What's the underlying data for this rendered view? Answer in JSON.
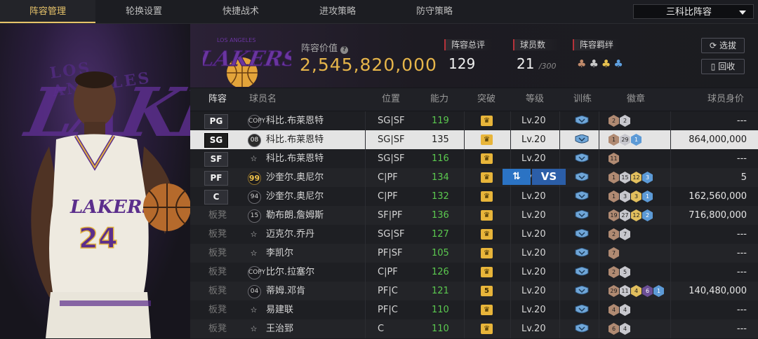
{
  "tabs": [
    "阵容管理",
    "轮换设置",
    "快捷战术",
    "进攻策略",
    "防守策略"
  ],
  "active_tab": 0,
  "team_select": {
    "value": "三科比阵容"
  },
  "logo_text": "LAKERS",
  "logo_arc": "LOS ANGELES",
  "lineup_value": {
    "label": "阵容价值",
    "value": "2,545,820,000"
  },
  "stats": {
    "rating": {
      "label": "阵容总评",
      "value": "129"
    },
    "players": {
      "label": "球员数",
      "value": "21",
      "max": "/300"
    },
    "bond": {
      "label": "阵容羁绊"
    }
  },
  "buttons": {
    "select": "选拔",
    "recycle": "回收",
    "swap_icon": "⇅",
    "vs": "VS"
  },
  "headers": {
    "lineup": "阵容",
    "name": "球员名",
    "position": "位置",
    "ability": "能力",
    "breakthrough": "突破",
    "level": "等级",
    "training": "训练",
    "badges": "徽章",
    "price": "球员身价"
  },
  "rows": [
    {
      "slot": "PG",
      "bench": false,
      "num": "COPY",
      "name": "科比.布莱恩特",
      "position": "SG|SF",
      "ability": "119",
      "ability_green": true,
      "break": "♛",
      "level": "Lv.20",
      "badges": [
        [
          "bronze",
          "2"
        ],
        [
          "silver",
          "2"
        ]
      ],
      "price": "---"
    },
    {
      "slot": "SG",
      "bench": false,
      "num": "08",
      "name": "科比.布莱恩特",
      "position": "SG|SF",
      "ability": "135",
      "ability_green": false,
      "break": "♛",
      "level": "Lv.20",
      "badges": [
        [
          "bronze",
          "1"
        ],
        [
          "silver",
          "29"
        ],
        [
          "blue",
          "1"
        ]
      ],
      "price": "864,000,000",
      "selected": true
    },
    {
      "slot": "SF",
      "bench": false,
      "num": "☆",
      "name": "科比.布莱恩特",
      "position": "SG|SF",
      "ability": "116",
      "ability_green": true,
      "break": "♛",
      "level": "Lv.20",
      "badges": [
        [
          "bronze",
          "11"
        ]
      ],
      "price": "---"
    },
    {
      "slot": "PF",
      "bench": false,
      "num": "99",
      "name": "沙奎尔.奥尼尔",
      "position": "C|PF",
      "ability": "134",
      "ability_green": true,
      "break": "♛",
      "level": "Lv.20",
      "badges": [
        [
          "bronze",
          "1"
        ],
        [
          "silver",
          "15"
        ],
        [
          "gold",
          "12"
        ],
        [
          "blue",
          "3"
        ]
      ],
      "price": "5"
    },
    {
      "slot": "C",
      "bench": false,
      "num": "94",
      "name": "沙奎尔.奥尼尔",
      "position": "C|PF",
      "ability": "132",
      "ability_green": true,
      "break": "♛",
      "level": "Lv.20",
      "badges": [
        [
          "bronze",
          "1"
        ],
        [
          "silver",
          "3"
        ],
        [
          "gold",
          "3"
        ],
        [
          "blue",
          "1"
        ]
      ],
      "price": "162,560,000"
    },
    {
      "slot": "板凳",
      "bench": true,
      "num": "15",
      "name": "勒布朗.詹姆斯",
      "position": "SF|PF",
      "ability": "136",
      "ability_green": true,
      "break": "♛",
      "level": "Lv.20",
      "badges": [
        [
          "bronze",
          "19"
        ],
        [
          "silver",
          "27"
        ],
        [
          "gold",
          "12"
        ],
        [
          "blue",
          "2"
        ]
      ],
      "price": "716,800,000"
    },
    {
      "slot": "板凳",
      "bench": true,
      "num": "☆",
      "name": "迈克尔.乔丹",
      "position": "SG|SF",
      "ability": "127",
      "ability_green": true,
      "break": "♛",
      "level": "Lv.20",
      "badges": [
        [
          "bronze",
          "2"
        ],
        [
          "silver",
          "7"
        ]
      ],
      "price": "---"
    },
    {
      "slot": "板凳",
      "bench": true,
      "num": "☆",
      "name": "李凯尔",
      "position": "PF|SF",
      "ability": "105",
      "ability_green": true,
      "break": "♛",
      "level": "Lv.20",
      "badges": [
        [
          "bronze",
          "7"
        ]
      ],
      "price": "---"
    },
    {
      "slot": "板凳",
      "bench": true,
      "num": "COPY",
      "name": "比尔.拉塞尔",
      "position": "C|PF",
      "ability": "126",
      "ability_green": true,
      "break": "♛",
      "level": "Lv.20",
      "badges": [
        [
          "bronze",
          "2"
        ],
        [
          "silver",
          "5"
        ]
      ],
      "price": "---"
    },
    {
      "slot": "板凳",
      "bench": true,
      "num": "04",
      "name": "蒂姆.邓肯",
      "position": "PF|C",
      "ability": "121",
      "ability_green": true,
      "break": "5",
      "level": "Lv.20",
      "badges": [
        [
          "bronze",
          "29"
        ],
        [
          "silver",
          "11"
        ],
        [
          "gold",
          "4"
        ],
        [
          "purple",
          "6"
        ],
        [
          "blue",
          "1"
        ]
      ],
      "price": "140,480,000"
    },
    {
      "slot": "板凳",
      "bench": true,
      "num": "☆",
      "name": "易建联",
      "position": "PF|C",
      "ability": "110",
      "ability_green": true,
      "break": "♛",
      "level": "Lv.20",
      "badges": [
        [
          "bronze",
          "4"
        ],
        [
          "silver",
          "4"
        ]
      ],
      "price": "---"
    },
    {
      "slot": "板凳",
      "bench": true,
      "num": "☆",
      "name": "王治郅",
      "position": "C",
      "ability": "110",
      "ability_green": true,
      "break": "♛",
      "level": "Lv.20",
      "badges": [
        [
          "bronze",
          "6"
        ],
        [
          "silver",
          "4"
        ]
      ],
      "price": "---"
    }
  ]
}
